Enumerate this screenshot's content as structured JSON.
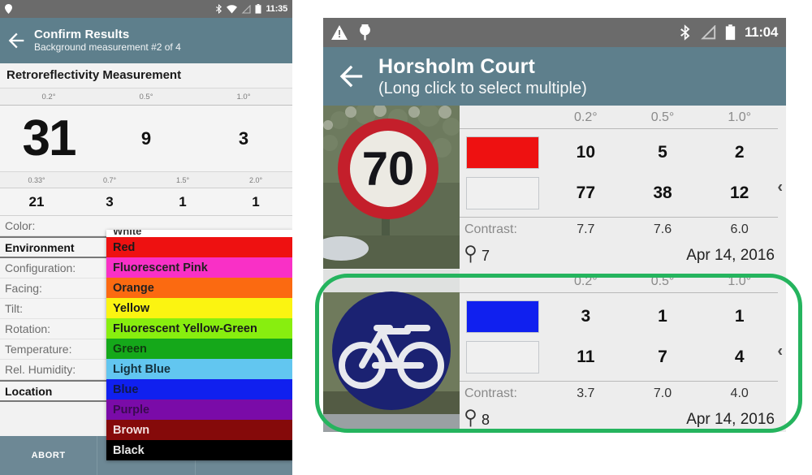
{
  "left_phone": {
    "status_bar": {
      "time": "11:35",
      "icons": [
        "location-pin-icon",
        "bluetooth-icon",
        "wifi-icon",
        "signal-icon",
        "battery-icon"
      ]
    },
    "app_bar": {
      "back_icon": "back-arrow-icon",
      "title": "Confirm Results",
      "subtitle": "Background measurement #2 of 4"
    },
    "section_title": "Retroreflectivity Measurement",
    "angle_header_1": [
      "0.2°",
      "0.5°",
      "1.0°"
    ],
    "values_1": [
      "31",
      "9",
      "3"
    ],
    "angle_header_2": [
      "0.33°",
      "0.7°",
      "1.5°",
      "2.0°"
    ],
    "values_2": [
      "21",
      "3",
      "1",
      "1"
    ],
    "fields": [
      {
        "label": "Color:",
        "bold": false
      },
      {
        "label": "Environment",
        "bold": true
      },
      {
        "label": "Configuration:",
        "bold": false
      },
      {
        "label": "Facing:",
        "bold": false
      },
      {
        "label": "Tilt:",
        "bold": false
      },
      {
        "label": "Rotation:",
        "bold": false
      },
      {
        "label": "Temperature:",
        "bold": false
      },
      {
        "label": "Rel. Humidity:",
        "bold": false
      },
      {
        "label": "Location",
        "bold": true
      }
    ],
    "color_dropdown": {
      "options": [
        {
          "label": "White",
          "bg": "#ffffff",
          "fg": "#333333",
          "clipped": true
        },
        {
          "label": "Red",
          "bg": "#ee1111",
          "fg": "#1a1a1a",
          "clipped": false
        },
        {
          "label": "Fluorescent Pink",
          "bg": "#f930c6",
          "fg": "#222222",
          "clipped": false
        },
        {
          "label": "Orange",
          "bg": "#fb6a11",
          "fg": "#222222",
          "clipped": false
        },
        {
          "label": "Yellow",
          "bg": "#fbf411",
          "fg": "#1a1a1a",
          "clipped": false
        },
        {
          "label": "Fluorescent Yellow-Green",
          "bg": "#88ee0f",
          "fg": "#1a1a1a",
          "clipped": false
        },
        {
          "label": "Green",
          "bg": "#15a81a",
          "fg": "#103b10",
          "clipped": false
        },
        {
          "label": "Light Blue",
          "bg": "#62c6f0",
          "fg": "#14303c",
          "clipped": false
        },
        {
          "label": "Blue",
          "bg": "#1020ef",
          "fg": "#101848",
          "clipped": false
        },
        {
          "label": "Purple",
          "bg": "#7a0ba8",
          "fg": "#3a0a50",
          "clipped": false
        },
        {
          "label": "Brown",
          "bg": "#850a0a",
          "fg": "#f2dede",
          "clipped": false
        },
        {
          "label": "Black",
          "bg": "#000000",
          "fg": "#e8e8e8",
          "clipped": false
        }
      ]
    },
    "bottom_bar": {
      "abort_label": "ABORT",
      "segments": [
        "ABORT",
        "",
        ""
      ]
    }
  },
  "right_phone": {
    "status_bar": {
      "time": "11:04",
      "left_icons": [
        "warning-icon",
        "location-pin-icon"
      ],
      "right_icons": [
        "bluetooth-icon",
        "signal-icon",
        "battery-icon"
      ]
    },
    "app_bar": {
      "back_icon": "back-arrow-icon",
      "title": "Horsholm Court",
      "subtitle": "(Long click to select multiple)"
    },
    "angle_columns": [
      "0.2°",
      "0.5°",
      "1.0°"
    ],
    "contrast_label": "Contrast:",
    "expand_icon": "chevron-left-icon",
    "cards": [
      {
        "sign_name": "speed-limit-70-sign",
        "sign_text": "70",
        "sign_type": "speed-limit",
        "swatch_color": "#ee1111",
        "swatch_color_2": "#f0f0f0",
        "row_1": [
          "10",
          "5",
          "2"
        ],
        "row_2": [
          "77",
          "38",
          "12"
        ],
        "contrast": [
          "7.7",
          "7.6",
          "6.0"
        ],
        "marker_count": "7",
        "date": "Apr 14, 2016",
        "highlighted": false
      },
      {
        "sign_name": "bicycle-route-sign",
        "sign_text": "",
        "sign_type": "bicycle",
        "swatch_color": "#1020ef",
        "swatch_color_2": "#f0f0f0",
        "row_1": [
          "3",
          "1",
          "1"
        ],
        "row_2": [
          "11",
          "7",
          "4"
        ],
        "contrast": [
          "3.7",
          "7.0",
          "4.0"
        ],
        "marker_count": "8",
        "date": "Apr 14, 2016",
        "highlighted": true
      }
    ]
  },
  "annotation": {
    "ring_color": "#25b45e",
    "ring_name": "green-highlight-ring"
  },
  "theme": {
    "app_bar": "#5e7f8c",
    "status_bar": "#6b6b6b",
    "bottom_bar": "#6d8895",
    "page_bg": "#f2f2f2",
    "card_bg": "#ededed"
  }
}
